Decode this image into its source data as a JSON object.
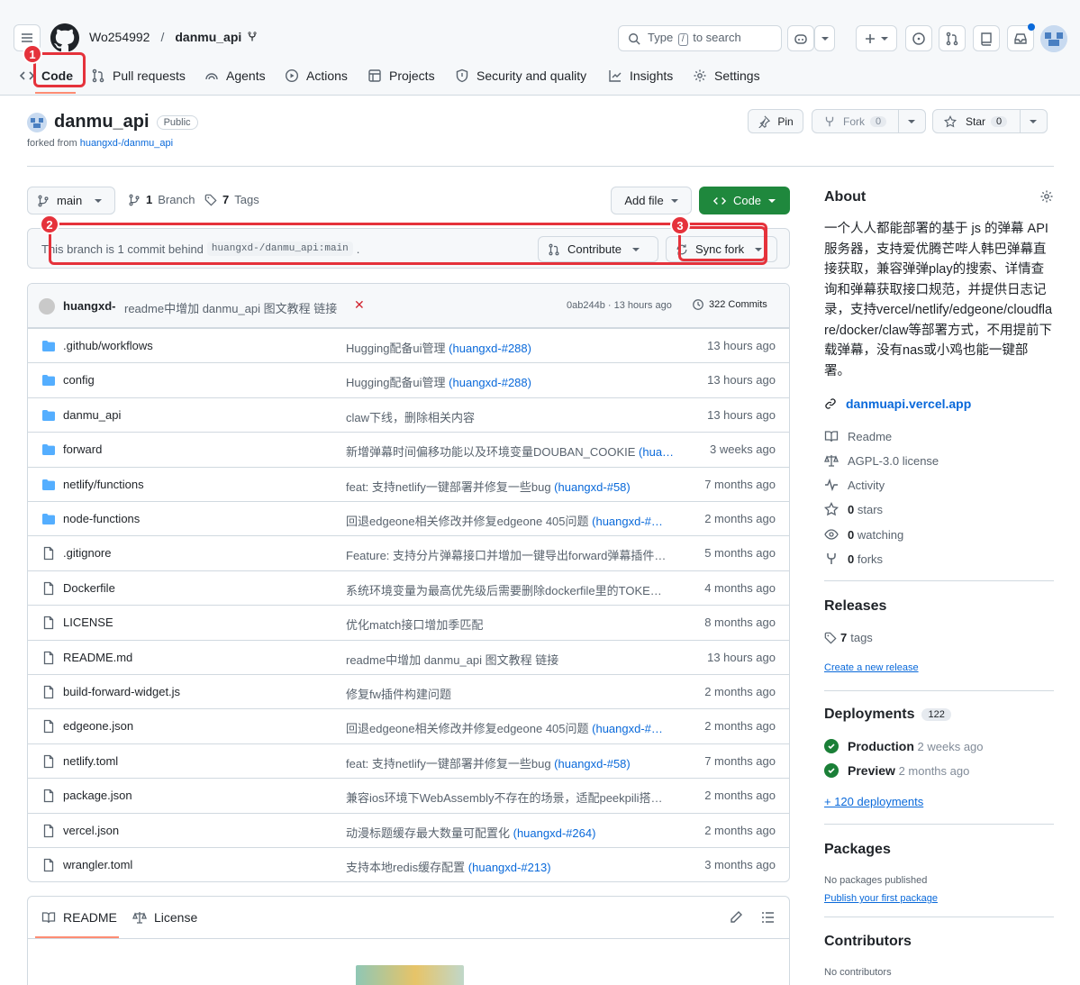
{
  "header": {
    "owner": "Wo254992",
    "separator": "/",
    "repo": "danmu_api",
    "search_placeholder_pre": "Type",
    "search_key": "/",
    "search_placeholder_post": "to search"
  },
  "tabs": [
    {
      "label": "Code",
      "icon": "code-icon"
    },
    {
      "label": "Pull requests",
      "icon": "git-pull-request-icon"
    },
    {
      "label": "Agents",
      "icon": "agent-icon"
    },
    {
      "label": "Actions",
      "icon": "play-icon"
    },
    {
      "label": "Projects",
      "icon": "table-icon"
    },
    {
      "label": "Security and quality",
      "icon": "shield-icon"
    },
    {
      "label": "Insights",
      "icon": "graph-icon"
    },
    {
      "label": "Settings",
      "icon": "gear-icon"
    }
  ],
  "annotations": [
    "1",
    "2",
    "3"
  ],
  "repo": {
    "name": "danmu_api",
    "visibility": "Public",
    "forked_from_label": "forked from",
    "forked_from": "huangxd-/danmu_api",
    "pin": "Pin",
    "fork": "Fork",
    "fork_count": "0",
    "star": "Star",
    "star_count": "0"
  },
  "branchbar": {
    "branch": "main",
    "branch_count": "1",
    "branch_label": "Branch",
    "tag_count": "7",
    "tag_label": "Tags",
    "add_file": "Add file",
    "code": "Code"
  },
  "behind": {
    "text": "This branch is 1 commit behind",
    "ref": "huangxd-/danmu_api:main",
    "period": ".",
    "contribute": "Contribute",
    "sync": "Sync fork"
  },
  "latest_commit": {
    "author": "huangxd-",
    "message": "readme中增加 danmu_api 图文教程 链接",
    "status": "✕",
    "sha_time": "0ab244b · 13 hours ago",
    "commits": "322 Commits"
  },
  "files": [
    {
      "name": ".github/workflows",
      "type": "dir",
      "msg": "Hugging配备ui管理 ",
      "link": "(huangxd-#288)",
      "time": "13 hours ago"
    },
    {
      "name": "config",
      "type": "dir",
      "msg": "Hugging配备ui管理 ",
      "link": "(huangxd-#288)",
      "time": "13 hours ago"
    },
    {
      "name": "danmu_api",
      "type": "dir",
      "msg": "claw下线，删除相关内容",
      "link": "",
      "time": "13 hours ago"
    },
    {
      "name": "forward",
      "type": "dir",
      "msg": "新增弹幕时间偏移功能以及环境变量DOUBAN_COOKIE ",
      "link": "(hua…",
      "time": "3 weeks ago"
    },
    {
      "name": "netlify/functions",
      "type": "dir",
      "msg": "feat: 支持netlify一键部署并修复一些bug ",
      "link": "(huangxd-#58)",
      "time": "7 months ago"
    },
    {
      "name": "node-functions",
      "type": "dir",
      "msg": "回退edgeone相关修改并修复edgeone 405问题 ",
      "link": "(huangxd-#…",
      "time": "2 months ago"
    },
    {
      "name": ".gitignore",
      "type": "file",
      "msg": "Feature: 支持分片弹幕接口并增加一键导出forward弹幕插件…",
      "link": "",
      "time": "5 months ago"
    },
    {
      "name": "Dockerfile",
      "type": "file",
      "msg": "系统环境变量为最高优先级后需要删除dockerfile里的TOKE…",
      "link": "",
      "time": "4 months ago"
    },
    {
      "name": "LICENSE",
      "type": "file",
      "msg": "优化match接口增加季匹配",
      "link": "",
      "time": "8 months ago"
    },
    {
      "name": "README.md",
      "type": "file",
      "msg": "readme中增加 danmu_api 图文教程 链接",
      "link": "",
      "time": "13 hours ago"
    },
    {
      "name": "build-forward-widget.js",
      "type": "file",
      "msg": "修复fw插件构建问题",
      "link": "",
      "time": "2 months ago"
    },
    {
      "name": "edgeone.json",
      "type": "file",
      "msg": "回退edgeone相关修改并修复edgeone 405问题 ",
      "link": "(huangxd-#…",
      "time": "2 months ago"
    },
    {
      "name": "netlify.toml",
      "type": "file",
      "msg": "feat: 支持netlify一键部署并修复一些bug ",
      "link": "(huangxd-#58)",
      "time": "7 months ago"
    },
    {
      "name": "package.json",
      "type": "file",
      "msg": "兼容ios环境下WebAssembly不存在的场景，适配peekpili搭…",
      "link": "",
      "time": "2 months ago"
    },
    {
      "name": "vercel.json",
      "type": "file",
      "msg": "动漫标题缓存最大数量可配置化 ",
      "link": "(huangxd-#264)",
      "time": "2 months ago"
    },
    {
      "name": "wrangler.toml",
      "type": "file",
      "msg": "支持本地redis缓存配置 ",
      "link": "(huangxd-#213)",
      "time": "3 months ago"
    }
  ],
  "readme": {
    "tab_readme": "README",
    "tab_license": "License"
  },
  "about": {
    "title": "About",
    "description": "一个人人都能部署的基于 js 的弹幕 API 服务器，支持爱优腾芒哔人韩巴弹幕直接获取，兼容弹弹play的搜索、详情查询和弹幕获取接口规范，并提供日志记录，支持vercel/netlify/edgeone/cloudflare/docker/claw等部署方式，不用提前下载弹幕，没有nas或小鸡也能一键部署。",
    "website": "danmuapi.vercel.app",
    "readme": "Readme",
    "license": "AGPL-3.0 license",
    "activity": "Activity",
    "stars_count": "0",
    "stars_label": "stars",
    "watching_count": "0",
    "watching_label": "watching",
    "forks_count": "0",
    "forks_label": "forks"
  },
  "releases": {
    "title": "Releases",
    "tags_count": "7",
    "tags_label": "tags",
    "create": "Create a new release"
  },
  "deployments": {
    "title": "Deployments",
    "count": "122",
    "items": [
      {
        "name": "Production",
        "time": "2 weeks ago"
      },
      {
        "name": "Preview",
        "time": "2 months ago"
      }
    ],
    "more": "+ 120 deployments"
  },
  "packages": {
    "title": "Packages",
    "none": "No packages published",
    "publish": "Publish your first package"
  },
  "contributors": {
    "title": "Contributors",
    "none": "No contributors"
  },
  "colors": {
    "accent": "#0969da",
    "primary_button": "#1f883d",
    "annotation": "#e5323b",
    "tab_underline": "#fd8c73",
    "folder": "#54aeff"
  }
}
